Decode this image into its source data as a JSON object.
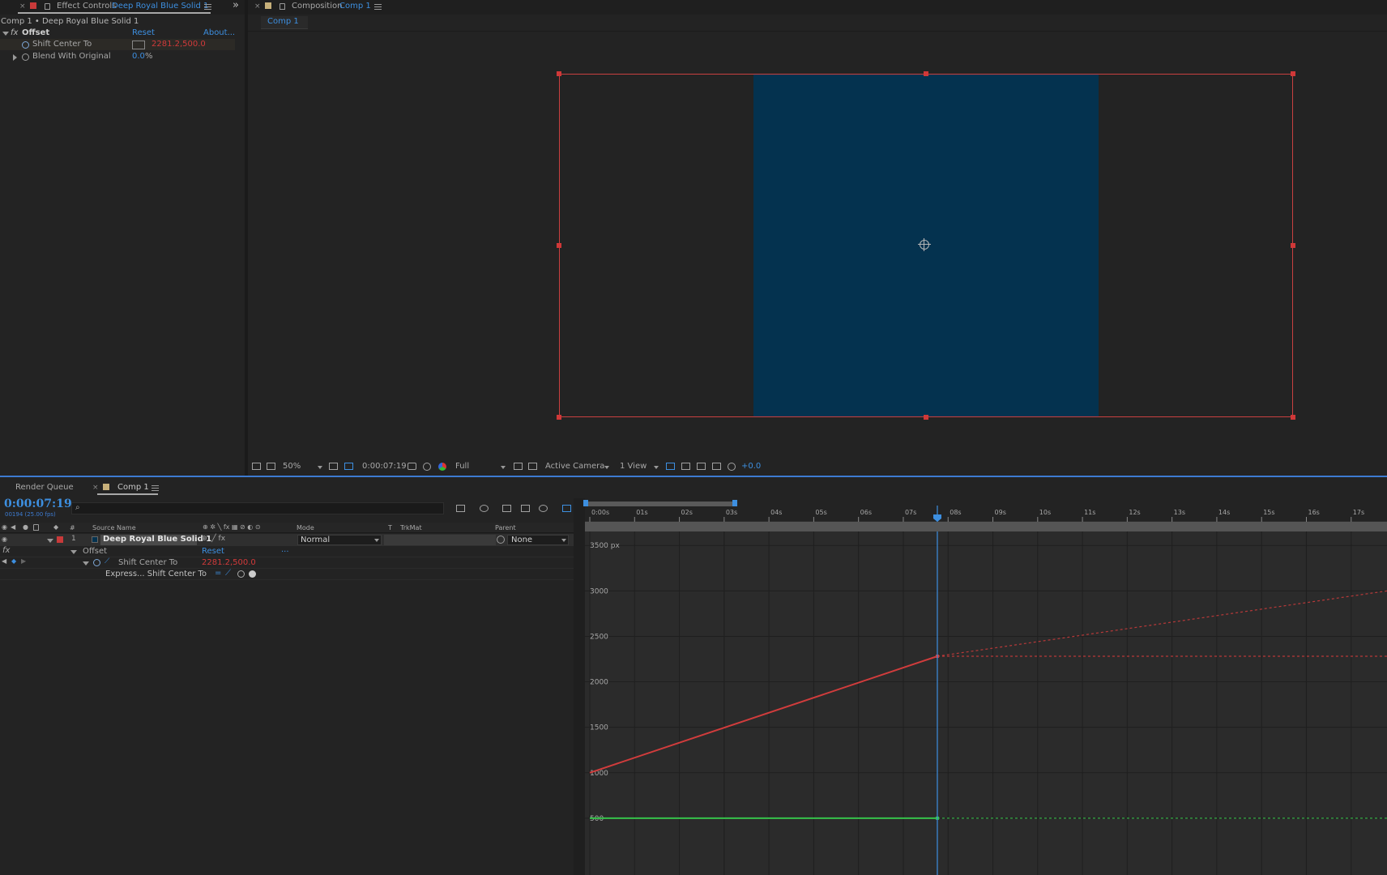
{
  "effect_controls": {
    "tab_title": "Effect Controls",
    "tab_layer": "Deep Royal Blue Solid 1",
    "breadcrumb": "Comp 1 • Deep Royal Blue Solid 1",
    "effect": {
      "fx_label": "fx",
      "name": "Offset",
      "reset": "Reset",
      "about": "About...",
      "properties": [
        {
          "name": "Shift Center To",
          "value": "2281.2,500.0"
        },
        {
          "name": "Blend With Original",
          "value": "0.0",
          "unit": "%"
        }
      ]
    },
    "expand_icon": "double-chevron-right-icon"
  },
  "composition": {
    "tab_title": "Composition",
    "tab_comp": "Comp 1",
    "subtab": "Comp 1",
    "solid_color": "#04324f",
    "bounds_color": "#c94040",
    "toolbar": {
      "zoom": "50%",
      "timecode": "0:00:07:19",
      "resolution": "Full",
      "camera": "Active Camera",
      "views": "1 View",
      "exposure": "+0.0"
    }
  },
  "timeline": {
    "tabs": {
      "render_queue": "Render Queue",
      "comp": "Comp 1"
    },
    "timecode": "0:00:07:19",
    "frame_info": "00194 (25.00 fps)",
    "columns": {
      "source_name": "Source Name",
      "hash": "#",
      "mode": "Mode",
      "t": "T",
      "trkmat": "TrkMat",
      "parent": "Parent"
    },
    "layer": {
      "number": "1",
      "name": "Deep Royal Blue Solid 1",
      "mode": "Normal",
      "parent": "None"
    },
    "effect_row": {
      "fx": "fx",
      "name": "Offset",
      "reset": "Reset",
      "more": "..."
    },
    "property_row": {
      "name": "Shift Center To",
      "value": "2281.2,500.0"
    },
    "expression_row": {
      "label": "Express... Shift Center To"
    },
    "ruler_ticks": [
      "0:00s",
      "01s",
      "02s",
      "03s",
      "04s",
      "05s",
      "06s",
      "07s",
      "08s",
      "09s",
      "10s",
      "11s",
      "12s",
      "13s",
      "14s",
      "15s",
      "16s",
      "17s"
    ],
    "accent_color": "#3d8fe0"
  },
  "chart_data": {
    "type": "line",
    "title": "",
    "xlabel": "",
    "ylabel": "",
    "x_unit": "s",
    "ylim": [
      0,
      3600
    ],
    "xlim": [
      0,
      17.8
    ],
    "y_ticks": [
      {
        "value": 3500,
        "label": "3500 px"
      },
      {
        "value": 3000,
        "label": "3000"
      },
      {
        "value": 2500,
        "label": "2500"
      },
      {
        "value": 2000,
        "label": "2000"
      },
      {
        "value": 1500,
        "label": "1500"
      },
      {
        "value": 1000,
        "label": "1000"
      },
      {
        "value": 500,
        "label": "500"
      }
    ],
    "current_time": 7.76,
    "series": [
      {
        "color": "#d13c3c",
        "x": [
          0,
          7.76
        ],
        "y": [
          1000,
          2281.2
        ],
        "continuation": [
          {
            "x": [
              7.76,
              17.8
            ],
            "y": [
              2281.2,
              3000
            ]
          },
          {
            "x": [
              7.76,
              17.8
            ],
            "y": [
              2281.2,
              2281.2
            ]
          }
        ]
      },
      {
        "color": "#36c24a",
        "x": [
          0,
          7.76
        ],
        "y": [
          500,
          500
        ],
        "continuation": [
          {
            "x": [
              7.76,
              17.8
            ],
            "y": [
              500,
              500
            ]
          }
        ]
      }
    ]
  }
}
